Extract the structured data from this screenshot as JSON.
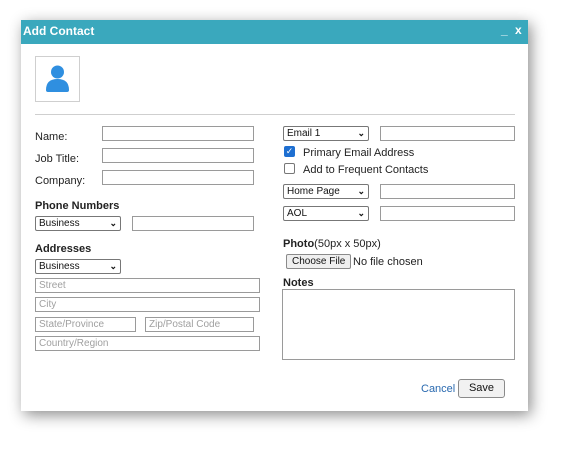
{
  "dialog": {
    "title": "Add Contact",
    "minimize_label": "_",
    "close_label": "x"
  },
  "form": {
    "name_label": "Name:",
    "job_title_label": "Job Title:",
    "company_label": "Company:",
    "phone_section": "Phone Numbers",
    "phone_type": "Business",
    "addresses_section": "Addresses",
    "address_type": "Business",
    "street_placeholder": "Street",
    "city_placeholder": "City",
    "state_placeholder": "State/Province",
    "zip_placeholder": "Zip/Postal Code",
    "country_placeholder": "Country/Region"
  },
  "right": {
    "email_type": "Email 1",
    "primary_email_label": "Primary Email Address",
    "primary_email_checked": true,
    "frequent_label": "Add to Frequent Contacts",
    "frequent_checked": false,
    "web_type": "Home Page",
    "im_type": "AOL",
    "photo_label": "Photo",
    "photo_hint": "(50px x 50px)",
    "choose_file_label": "Choose File",
    "no_file_text": "No file chosen",
    "notes_label": "Notes"
  },
  "actions": {
    "cancel_label": "Cancel",
    "save_label": "Save"
  },
  "icons": {
    "avatar": "user-avatar-icon",
    "chevron": "chevron-down-icon"
  },
  "colors": {
    "titlebar": "#3aa8bd",
    "avatar": "#2f8fe0",
    "link": "#2a6ab0",
    "checkbox": "#1e6fd1"
  }
}
